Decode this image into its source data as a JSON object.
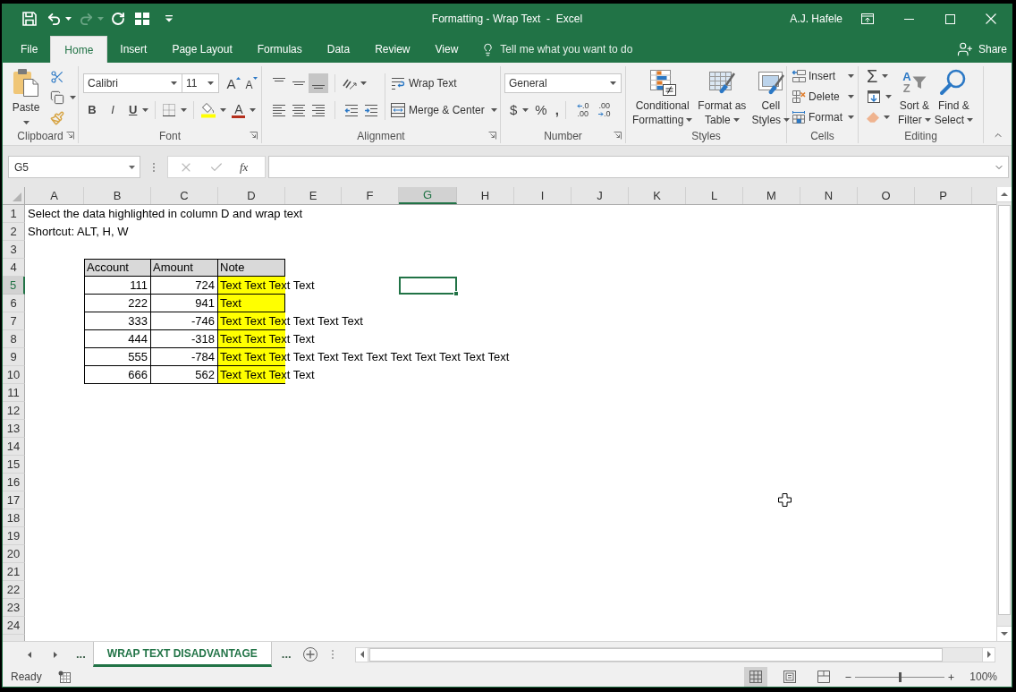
{
  "window": {
    "title": "Formatting - Wrap Text  -  Excel",
    "user": "A.J. Hafele"
  },
  "quick_access": [
    {
      "kind": "save",
      "disabled": false
    },
    {
      "kind": "undo",
      "disabled": false
    },
    {
      "kind": "redo",
      "disabled": true
    },
    {
      "kind": "repeat",
      "disabled": false
    },
    {
      "kind": "form",
      "disabled": false
    },
    {
      "kind": "customize",
      "disabled": false
    }
  ],
  "ribbon_tabs": [
    {
      "label": "File",
      "selected": false
    },
    {
      "label": "Home",
      "selected": true
    },
    {
      "label": "Insert",
      "selected": false
    },
    {
      "label": "Page Layout",
      "selected": false
    },
    {
      "label": "Formulas",
      "selected": false
    },
    {
      "label": "Data",
      "selected": false
    },
    {
      "label": "Review",
      "selected": false
    },
    {
      "label": "View",
      "selected": false
    }
  ],
  "tell_me": {
    "placeholder": "Tell me what you want to do"
  },
  "share": {
    "label": "Share"
  },
  "ribbon": {
    "clipboard": {
      "label": "Clipboard",
      "paste": "Paste"
    },
    "font": {
      "label": "Font",
      "font_name": "Calibri",
      "font_size": "11",
      "grow": "A",
      "shrink": "A",
      "bold": "B",
      "italic": "I",
      "underline": "U",
      "font_color": "A"
    },
    "alignment": {
      "label": "Alignment",
      "vertical": [
        {
          "kind": "top",
          "selected": false
        },
        {
          "kind": "middle",
          "selected": false
        },
        {
          "kind": "bottom",
          "selected": true
        }
      ],
      "horizontal": [
        {
          "kind": "left",
          "selected": false
        },
        {
          "kind": "center",
          "selected": false
        },
        {
          "kind": "right",
          "selected": false
        }
      ],
      "wrap_text": "Wrap Text",
      "merge": "Merge & Center"
    },
    "number": {
      "label": "Number",
      "format": "General",
      "currency": "$",
      "percent": "%",
      "comma": ",",
      "decimals": [
        {
          "kind": "increase",
          "top": ".0",
          "bottom": ".00"
        },
        {
          "kind": "decrease",
          "top": ".00",
          "bottom": ".0"
        }
      ]
    },
    "styles": {
      "label": "Styles",
      "buttons": [
        {
          "kind": "conditional",
          "lines": [
            "Conditional",
            "Formatting"
          ]
        },
        {
          "kind": "table",
          "lines": [
            "Format as",
            "Table"
          ]
        },
        {
          "kind": "cell_styles",
          "lines": [
            "Cell",
            "Styles"
          ]
        }
      ]
    },
    "cells": {
      "label": "Cells",
      "buttons": [
        {
          "kind": "insert",
          "label": "Insert"
        },
        {
          "kind": "delete",
          "label": "Delete"
        },
        {
          "kind": "format",
          "label": "Format"
        }
      ]
    },
    "editing": {
      "label": "Editing",
      "autosum": "Σ",
      "sort_letters": [
        "A",
        "Z"
      ],
      "buttons": [
        {
          "kind": "sort",
          "lines": [
            "Sort &",
            "Filter"
          ]
        },
        {
          "kind": "find",
          "lines": [
            "Find &",
            "Select"
          ]
        }
      ]
    }
  },
  "formula_bar": {
    "name_box": "G5",
    "buttons": [
      {
        "kind": "cancel",
        "disabled": true
      },
      {
        "kind": "enter",
        "disabled": true
      }
    ],
    "function_label": "fx"
  },
  "sheet": {
    "columns": [
      {
        "label": "A",
        "selected": false
      },
      {
        "label": "B",
        "selected": false
      },
      {
        "label": "C",
        "selected": false
      },
      {
        "label": "D",
        "selected": false
      },
      {
        "label": "E",
        "selected": false
      },
      {
        "label": "F",
        "selected": false
      },
      {
        "label": "G",
        "selected": true
      },
      {
        "label": "H",
        "selected": false
      },
      {
        "label": "I",
        "selected": false
      },
      {
        "label": "J",
        "selected": false
      },
      {
        "label": "K",
        "selected": false
      },
      {
        "label": "L",
        "selected": false
      },
      {
        "label": "M",
        "selected": false
      },
      {
        "label": "N",
        "selected": false
      },
      {
        "label": "O",
        "selected": false
      },
      {
        "label": "P",
        "selected": false
      }
    ],
    "rows": [
      {
        "label": "1",
        "selected": false,
        "cells": [
          {
            "kind": "text",
            "text": "Select the data highlighted in column D and wrap text"
          }
        ]
      },
      {
        "label": "2",
        "selected": false,
        "cells": [
          {
            "kind": "text",
            "text": "Shortcut: ALT, H, W"
          }
        ]
      },
      {
        "label": "3",
        "selected": false
      },
      {
        "label": "4",
        "selected": false,
        "cells": [
          {
            "kind": "empty"
          },
          {
            "kind": "header",
            "text": "Account"
          },
          {
            "kind": "header",
            "text": "Amount"
          },
          {
            "kind": "header",
            "text": "Note"
          }
        ]
      },
      {
        "label": "5",
        "selected": true,
        "cells": [
          {
            "kind": "empty"
          },
          {
            "kind": "number",
            "text": "111"
          },
          {
            "kind": "number",
            "text": "724"
          },
          {
            "kind": "note",
            "text": "Text Text Text Text",
            "overflow": true
          }
        ]
      },
      {
        "label": "6",
        "selected": false,
        "cells": [
          {
            "kind": "empty"
          },
          {
            "kind": "number",
            "text": "222"
          },
          {
            "kind": "number",
            "text": "941"
          },
          {
            "kind": "note",
            "text": "Text",
            "overflow": false
          }
        ]
      },
      {
        "label": "7",
        "selected": false,
        "cells": [
          {
            "kind": "empty"
          },
          {
            "kind": "number",
            "text": "333"
          },
          {
            "kind": "number",
            "text": "-746"
          },
          {
            "kind": "note",
            "text": "Text Text Text Text Text Text",
            "overflow": true
          }
        ]
      },
      {
        "label": "8",
        "selected": false,
        "cells": [
          {
            "kind": "empty"
          },
          {
            "kind": "number",
            "text": "444"
          },
          {
            "kind": "number",
            "text": "-318"
          },
          {
            "kind": "note",
            "text": "Text Text Text Text",
            "overflow": true
          }
        ]
      },
      {
        "label": "9",
        "selected": false,
        "cells": [
          {
            "kind": "empty"
          },
          {
            "kind": "number",
            "text": "555"
          },
          {
            "kind": "number",
            "text": "-784"
          },
          {
            "kind": "note",
            "text": "Text Text Text Text Text Text Text Text Text Text Text Text",
            "overflow": true
          }
        ]
      },
      {
        "label": "10",
        "selected": false,
        "cells": [
          {
            "kind": "empty"
          },
          {
            "kind": "number",
            "text": "666"
          },
          {
            "kind": "number",
            "text": "562"
          },
          {
            "kind": "note",
            "text": "Text Text Text Text",
            "overflow": true
          }
        ]
      },
      {
        "label": "11",
        "selected": false
      },
      {
        "label": "12",
        "selected": false
      },
      {
        "label": "13",
        "selected": false
      },
      {
        "label": "14",
        "selected": false
      },
      {
        "label": "15",
        "selected": false
      },
      {
        "label": "16",
        "selected": false
      },
      {
        "label": "17",
        "selected": false
      },
      {
        "label": "18",
        "selected": false
      },
      {
        "label": "19",
        "selected": false
      },
      {
        "label": "20",
        "selected": false
      },
      {
        "label": "21",
        "selected": false
      },
      {
        "label": "22",
        "selected": false
      },
      {
        "label": "23",
        "selected": false
      },
      {
        "label": "24",
        "selected": false
      }
    ]
  },
  "sheet_tabs": {
    "more_before": "...",
    "tabs": [
      {
        "label": "WRAP TEXT DISADVANTAGE",
        "selected": true
      }
    ],
    "more_after": "..."
  },
  "status_bar": {
    "status": "Ready",
    "views": [
      {
        "kind": "normal",
        "selected": true
      },
      {
        "kind": "page_layout",
        "selected": false
      },
      {
        "kind": "page_break",
        "selected": false
      }
    ],
    "zoom": {
      "level": 0.5,
      "reading": "100%"
    }
  }
}
